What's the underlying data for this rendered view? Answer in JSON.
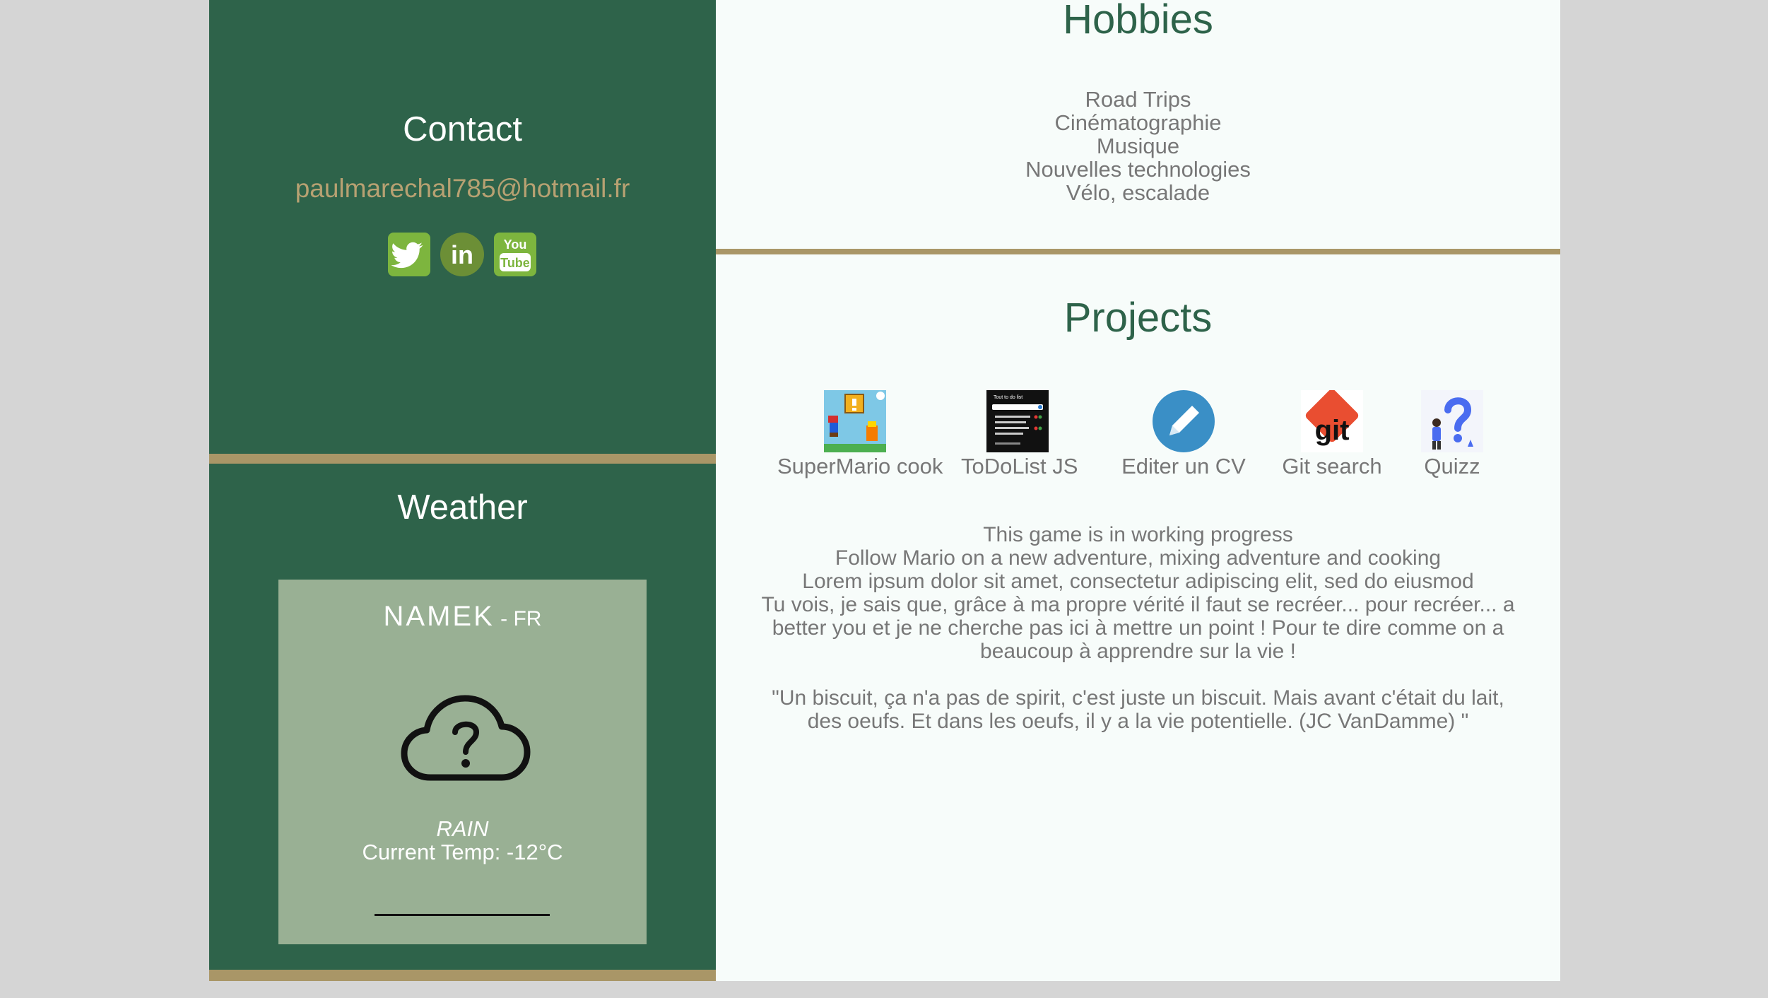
{
  "contact": {
    "title": "Contact",
    "email": "paulmarechal785@hotmail.fr",
    "socials": [
      {
        "name": "twitter-icon"
      },
      {
        "name": "linkedin-icon",
        "text": "in"
      },
      {
        "name": "youtube-icon",
        "text_top": "You",
        "text_bottom": "Tube"
      }
    ]
  },
  "weather": {
    "title": "Weather",
    "city": "NAMEK",
    "country": " - FR",
    "icon": "cloud-question-icon",
    "condition": "RAIN",
    "temp": "Current Temp: -12°C"
  },
  "hobbies": {
    "title": "Hobbies",
    "items": [
      "Road Trips",
      "Cinématographie",
      "Musique",
      "Nouvelles technologies",
      "Vélo, escalade"
    ]
  },
  "projects": {
    "title": "Projects",
    "items": [
      {
        "label": "SuperMario cook",
        "icon": "supermario-thumbnail"
      },
      {
        "label": "ToDoList JS",
        "icon": "todolist-thumbnail",
        "thumb_text": "Tout to do list"
      },
      {
        "label": "Editer un CV",
        "icon": "pencil-icon"
      },
      {
        "label": "Git search",
        "icon": "git-logo",
        "thumb_text": "git"
      },
      {
        "label": "Quizz",
        "icon": "quizz-thumbnail"
      }
    ],
    "description": {
      "line1": "This game is in working progress",
      "line2": "Follow Mario on a new adventure, mixing adventure and cooking",
      "line3": "Lorem ipsum dolor sit amet, consectetur adipiscing elit, sed do eiusmod",
      "line4": "Tu vois, je sais que, grâce à ma propre vérité il faut se recréer... pour recréer... a better you et je ne cherche pas ici à mettre un point ! Pour te dire comme on a beaucoup à apprendre sur la vie !",
      "quote": "\"Un biscuit, ça n'a pas de spirit, c'est juste un biscuit. Mais avant c'était du lait, des oeufs. Et dans les oeufs, il y a la vie potentielle. (JC VanDamme) \""
    }
  },
  "colors": {
    "dark_green": "#2e634a",
    "gold": "#a99667",
    "sage": "#99b094",
    "panel_bg": "#f7fcfa"
  }
}
